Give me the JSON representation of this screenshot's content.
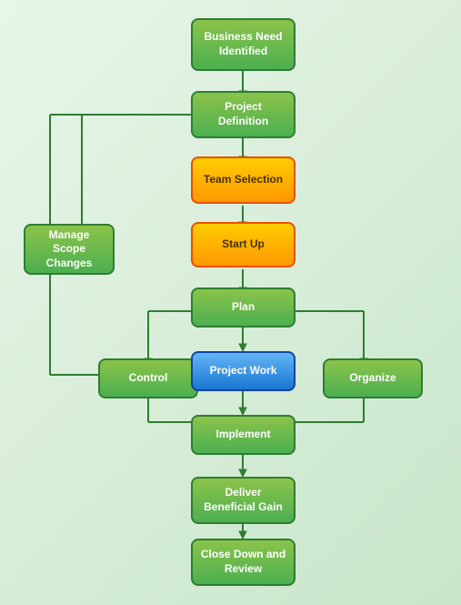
{
  "nodes": {
    "business_need": {
      "label": "Business Need Identified"
    },
    "project_definition": {
      "label": "Project Definition"
    },
    "team_selection": {
      "label": "Team Selection"
    },
    "start_up": {
      "label": "Start Up"
    },
    "plan": {
      "label": "Plan"
    },
    "control": {
      "label": "Control"
    },
    "project_work": {
      "label": "Project Work"
    },
    "organize": {
      "label": "Organize"
    },
    "implement": {
      "label": "Implement"
    },
    "deliver": {
      "label": "Deliver Beneficial Gain"
    },
    "close_down": {
      "label": "Close Down and Review"
    },
    "manage_scope": {
      "label": "Manage Scope Changes"
    }
  }
}
